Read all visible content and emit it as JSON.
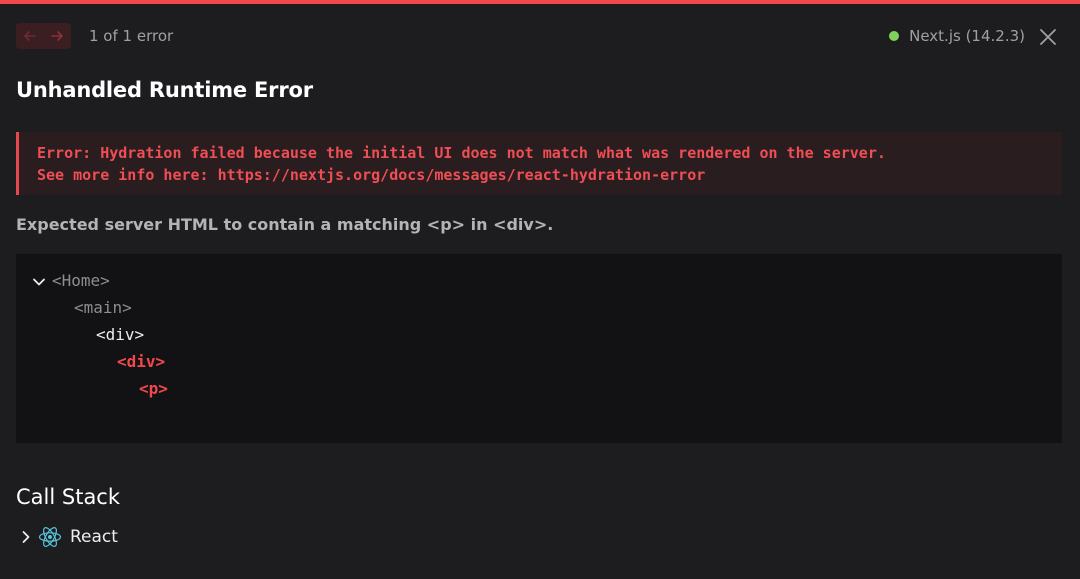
{
  "header": {
    "error_count": "1 of 1 error",
    "version": "Next.js (14.2.3)"
  },
  "title": "Unhandled Runtime Error",
  "error": {
    "line1": "Error: Hydration failed because the initial UI does not match what was rendered on the server.",
    "line2": "See more info here: https://nextjs.org/docs/messages/react-hydration-error"
  },
  "description": "Expected server HTML to contain a matching <p> in <div>.",
  "component_tree": [
    {
      "text": "<Home>",
      "style": "muted",
      "indent": 0
    },
    {
      "text": "<main>",
      "style": "muted",
      "indent": 1
    },
    {
      "text": "<div>",
      "style": "normal",
      "indent": 2
    },
    {
      "text": "<div>",
      "style": "highlight",
      "indent": 3
    },
    {
      "text": "<p>",
      "style": "highlight",
      "indent": 4
    }
  ],
  "call_stack": {
    "title": "Call Stack",
    "items": [
      {
        "label": "React",
        "icon": "react-icon"
      }
    ]
  },
  "colors": {
    "accent": "#f0484d",
    "status_ok": "#7fd35c",
    "react_blue": "#58c4dc"
  },
  "icons": {
    "prev": "arrow-left-icon",
    "next": "arrow-right-icon",
    "close": "close-icon",
    "expand": "chevron-down-icon",
    "collapse": "chevron-right-icon"
  }
}
